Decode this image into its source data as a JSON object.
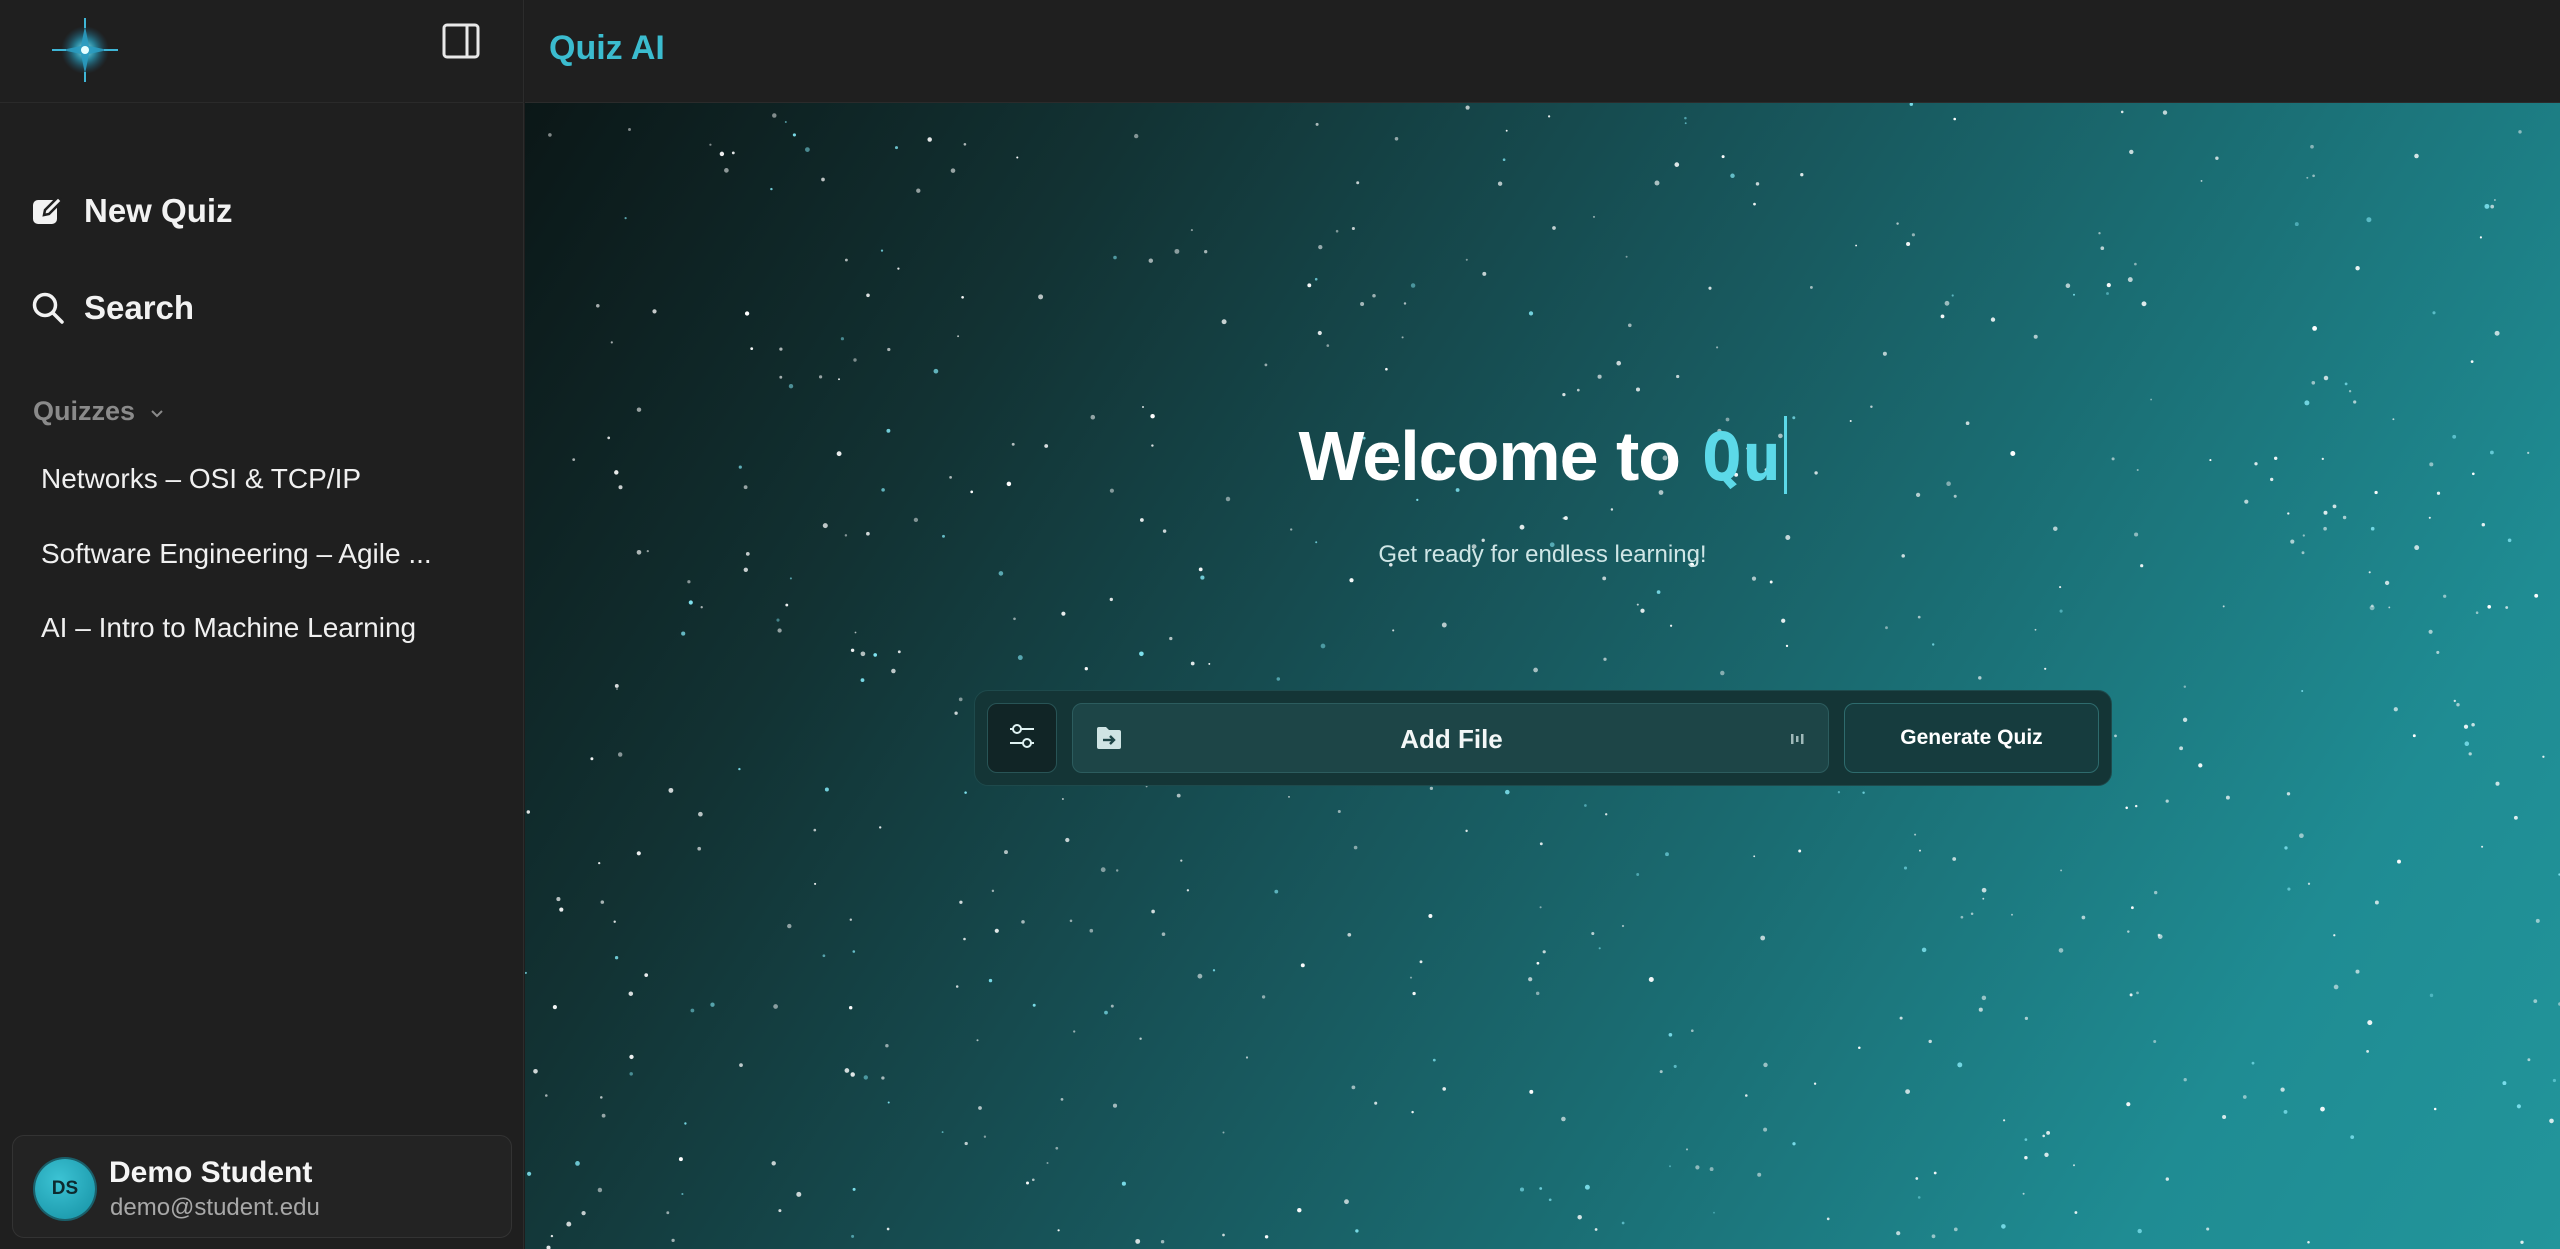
{
  "sidebar": {
    "logo_icon": "sparkle-logo-icon",
    "toggle_icon": "sidebar-panel-icon",
    "nav": {
      "new_quiz": "New Quiz",
      "search": "Search"
    },
    "quizzes_heading": "Quizzes",
    "quizzes": [
      "Networks – OSI & TCP/IP",
      "Software Engineering – Agile ...",
      "AI – Intro to Machine Learning"
    ],
    "user": {
      "initials": "DS",
      "name": "Demo Student",
      "email": "demo@student.edu"
    }
  },
  "header": {
    "title": "Quiz AI"
  },
  "hero": {
    "welcome": "Welcome to",
    "typed": "Qu",
    "subtitle": "Get ready for endless learning!"
  },
  "actions": {
    "file_label": "Add File",
    "generate_label": "Generate Quiz"
  },
  "colors": {
    "accent": "#3bbccf",
    "typed_text": "#5cd9e8",
    "sidebar_bg": "#1f1f1f",
    "hero_start": "#0b1717",
    "hero_end": "#22959b"
  }
}
